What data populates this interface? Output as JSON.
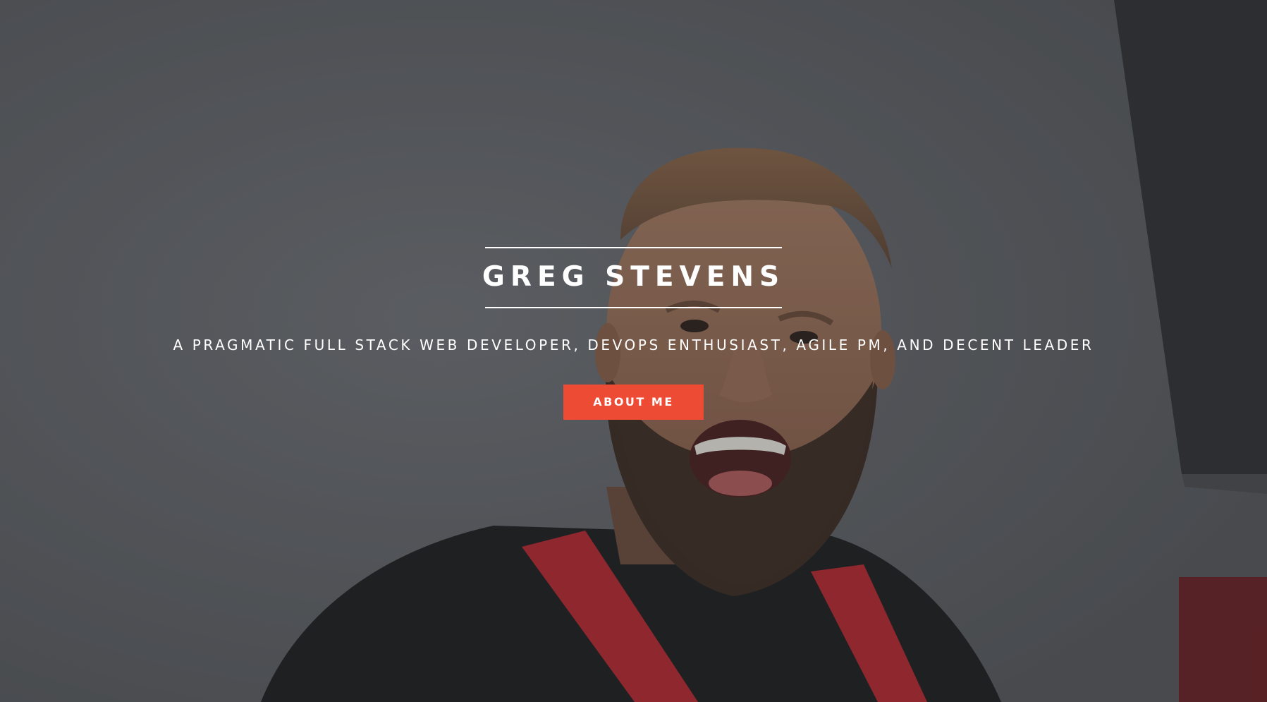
{
  "hero": {
    "title": "GREG STEVENS",
    "tagline": "A PRAGMATIC FULL STACK WEB DEVELOPER, DEVOPS ENTHUSIAST, AGILE PM, AND DECENT LEADER",
    "cta_label": "ABOUT ME",
    "background_image": "portrait-photo"
  },
  "colors": {
    "accent": "#ee4b35",
    "text": "#ffffff",
    "background": "#5d5f63"
  }
}
